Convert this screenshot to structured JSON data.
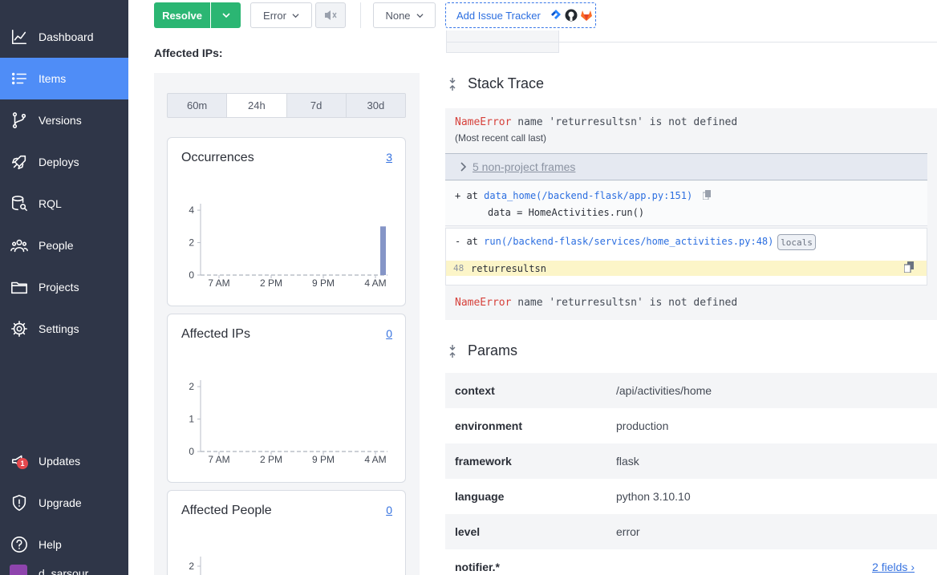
{
  "sidebar": {
    "items": [
      {
        "label": "Dashboard",
        "icon": "chart-line-icon"
      },
      {
        "label": "Items",
        "icon": "list-icon",
        "active": true
      },
      {
        "label": "Versions",
        "icon": "branch-icon"
      },
      {
        "label": "Deploys",
        "icon": "rocket-icon"
      },
      {
        "label": "RQL",
        "icon": "database-search-icon"
      },
      {
        "label": "People",
        "icon": "people-icon"
      },
      {
        "label": "Projects",
        "icon": "folder-icon"
      },
      {
        "label": "Settings",
        "icon": "gear-icon"
      }
    ],
    "bottom": [
      {
        "label": "Updates",
        "icon": "megaphone-icon",
        "badge": "1"
      },
      {
        "label": "Upgrade",
        "icon": "shield-icon"
      },
      {
        "label": "Help",
        "icon": "help-icon"
      }
    ],
    "user": "d_sarsour"
  },
  "toolbar": {
    "resolve_label": "Resolve",
    "level_label": "Error",
    "assignee_label": "None",
    "tracker_label": "Add Issue Tracker"
  },
  "affected_ips_heading": "Affected IPs:",
  "range_tabs": [
    "60m",
    "24h",
    "7d",
    "30d"
  ],
  "range_active": "24h",
  "cards": [
    {
      "title": "Occurrences",
      "count": "3"
    },
    {
      "title": "Affected IPs",
      "count": "0"
    },
    {
      "title": "Affected People",
      "count": "0"
    }
  ],
  "chart_data": [
    {
      "type": "bar",
      "title": "Occurrences",
      "x_ticks": [
        "7 AM",
        "2 PM",
        "9 PM",
        "4 AM"
      ],
      "y_ticks": [
        "0",
        "2",
        "4"
      ],
      "ylim": [
        0,
        4.4
      ],
      "bars": [
        {
          "position": "4 AM",
          "value": 3
        }
      ]
    },
    {
      "type": "bar",
      "title": "Affected IPs",
      "x_ticks": [
        "7 AM",
        "2 PM",
        "9 PM",
        "4 AM"
      ],
      "y_ticks": [
        "0",
        "1",
        "2"
      ],
      "ylim": [
        0,
        2.2
      ],
      "bars": []
    },
    {
      "type": "bar",
      "title": "Affected People",
      "y_ticks": [
        "2"
      ],
      "bars": []
    }
  ],
  "stack_trace": {
    "title": "Stack Trace",
    "error_type": "NameError",
    "error_msg": "name 'returresultsn' is not defined",
    "recent_call": "(Most recent call last)",
    "frames_toggle": "5 non-project frames",
    "frame1_prefix": "+ at",
    "frame1_fn": "data_home(/backend-flask/app.py:151)",
    "frame1_code": "data = HomeActivities.run()",
    "frame1_code_fn": "HomeActivities.run",
    "frame2_prefix": "- at",
    "frame2_fn": "run(/backend-flask/services/home_activities.py:48)",
    "locals_label": "locals",
    "line_no": "48",
    "line_code": "returresultsn"
  },
  "params": {
    "title": "Params",
    "rows": [
      {
        "key": "context",
        "value": "/api/activities/home"
      },
      {
        "key": "environment",
        "value": "production"
      },
      {
        "key": "framework",
        "value": "flask"
      },
      {
        "key": "language",
        "value": "python 3.10.10"
      },
      {
        "key": "level",
        "value": "error"
      },
      {
        "key": "notifier.*",
        "value": "",
        "link": "2 fields"
      }
    ]
  },
  "colors": {
    "sidebar_bg": "#2f3648",
    "active_nav": "#4f8df7",
    "resolve_green": "#2bb673",
    "link_blue": "#3773e0",
    "error_red": "#d6413b",
    "bar_fill": "#8595c7"
  }
}
